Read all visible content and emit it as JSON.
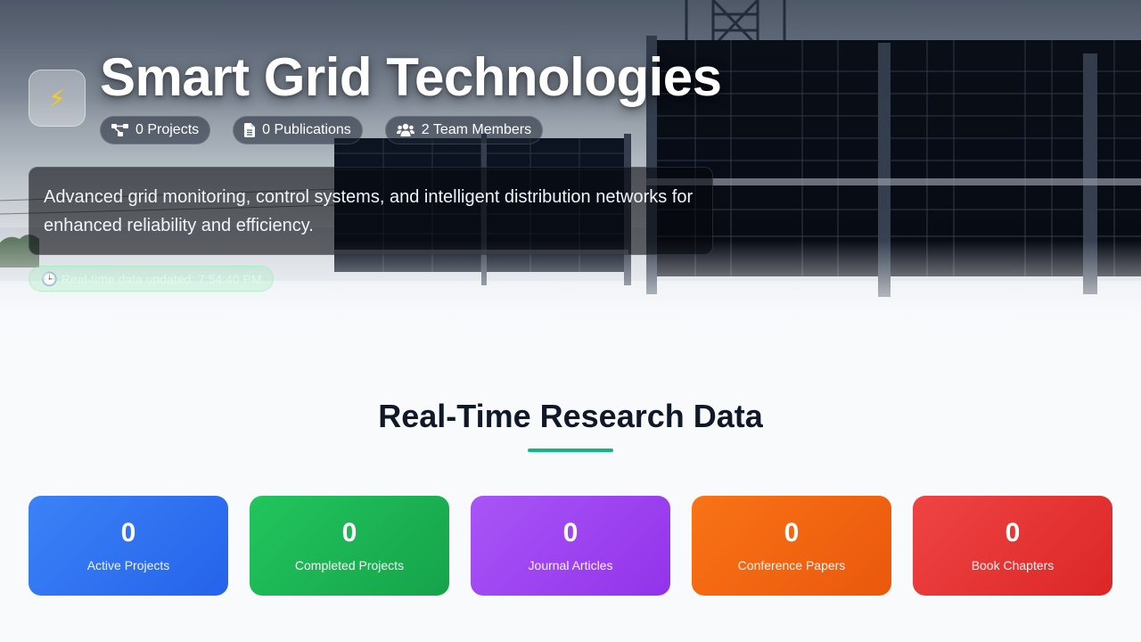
{
  "hero": {
    "logo_icon": "lightning-bolt-icon",
    "logo_glyph": "⚡",
    "title": "Smart Grid Technologies",
    "stats": [
      {
        "icon": "project-diagram-icon",
        "label": "0 Projects"
      },
      {
        "icon": "document-icon",
        "label": "0 Publications"
      },
      {
        "icon": "users-icon",
        "label": "2 Team Members"
      }
    ],
    "description": "Advanced grid monitoring, control systems, and intelligent distribution networks for enhanced reliability and efficiency.",
    "update_badge": {
      "icon": "clock-icon",
      "icon_glyph": "🕒",
      "text": "Real-time data updated: 7:54:40 PM"
    }
  },
  "section": {
    "title": "Real-Time Research Data",
    "accent_color": "#10b981",
    "cards": [
      {
        "value": "0",
        "label": "Active Projects",
        "color_from": "#3b82f6",
        "color_to": "#2563eb"
      },
      {
        "value": "0",
        "label": "Completed Projects",
        "color_from": "#22c55e",
        "color_to": "#16a34a"
      },
      {
        "value": "0",
        "label": "Journal Articles",
        "color_from": "#a855f7",
        "color_to": "#9333ea"
      },
      {
        "value": "0",
        "label": "Conference Papers",
        "color_from": "#f97316",
        "color_to": "#ea580c"
      },
      {
        "value": "0",
        "label": "Book Chapters",
        "color_from": "#ef4444",
        "color_to": "#dc2626"
      }
    ]
  }
}
